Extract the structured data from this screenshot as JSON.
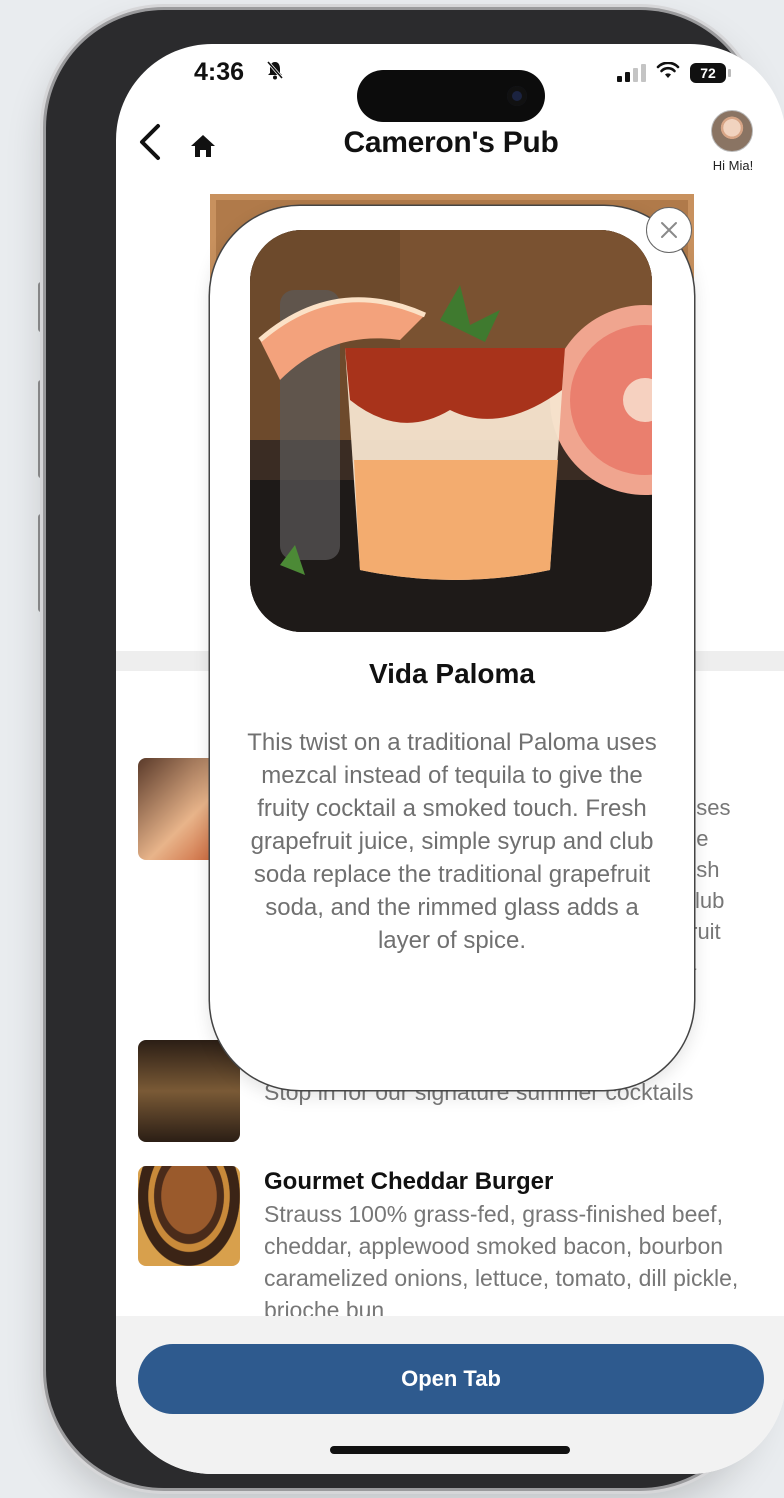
{
  "status_bar": {
    "time": "4:36",
    "battery": "72"
  },
  "header": {
    "title": "Cameron's Pub",
    "greeting": "Hi Mia!"
  },
  "background_items": {
    "peek_lines": [
      "uses",
      "he",
      "esh",
      "club",
      "fruit",
      "a"
    ],
    "item2_desc": "Stop in for our signature summer cocktails",
    "item3_title": "Gourmet Cheddar Burger",
    "item3_desc": "Strauss 100% grass-fed, grass-finished beef, cheddar, applewood smoked bacon, bourbon caramelized onions, lettuce, tomato, dill pickle, brioche bun"
  },
  "modal": {
    "name": "Vida Paloma",
    "description": "This twist on a traditional Paloma uses mezcal instead of tequila to give the fruity cocktail a smoked touch. Fresh grapefruit juice, simple syrup and club soda replace the traditional grapefruit soda, and the rimmed glass adds a layer of spice."
  },
  "footer": {
    "open_tab_label": "Open Tab"
  },
  "colors": {
    "accent": "#2e5a8e",
    "muted_text": "#707070"
  }
}
